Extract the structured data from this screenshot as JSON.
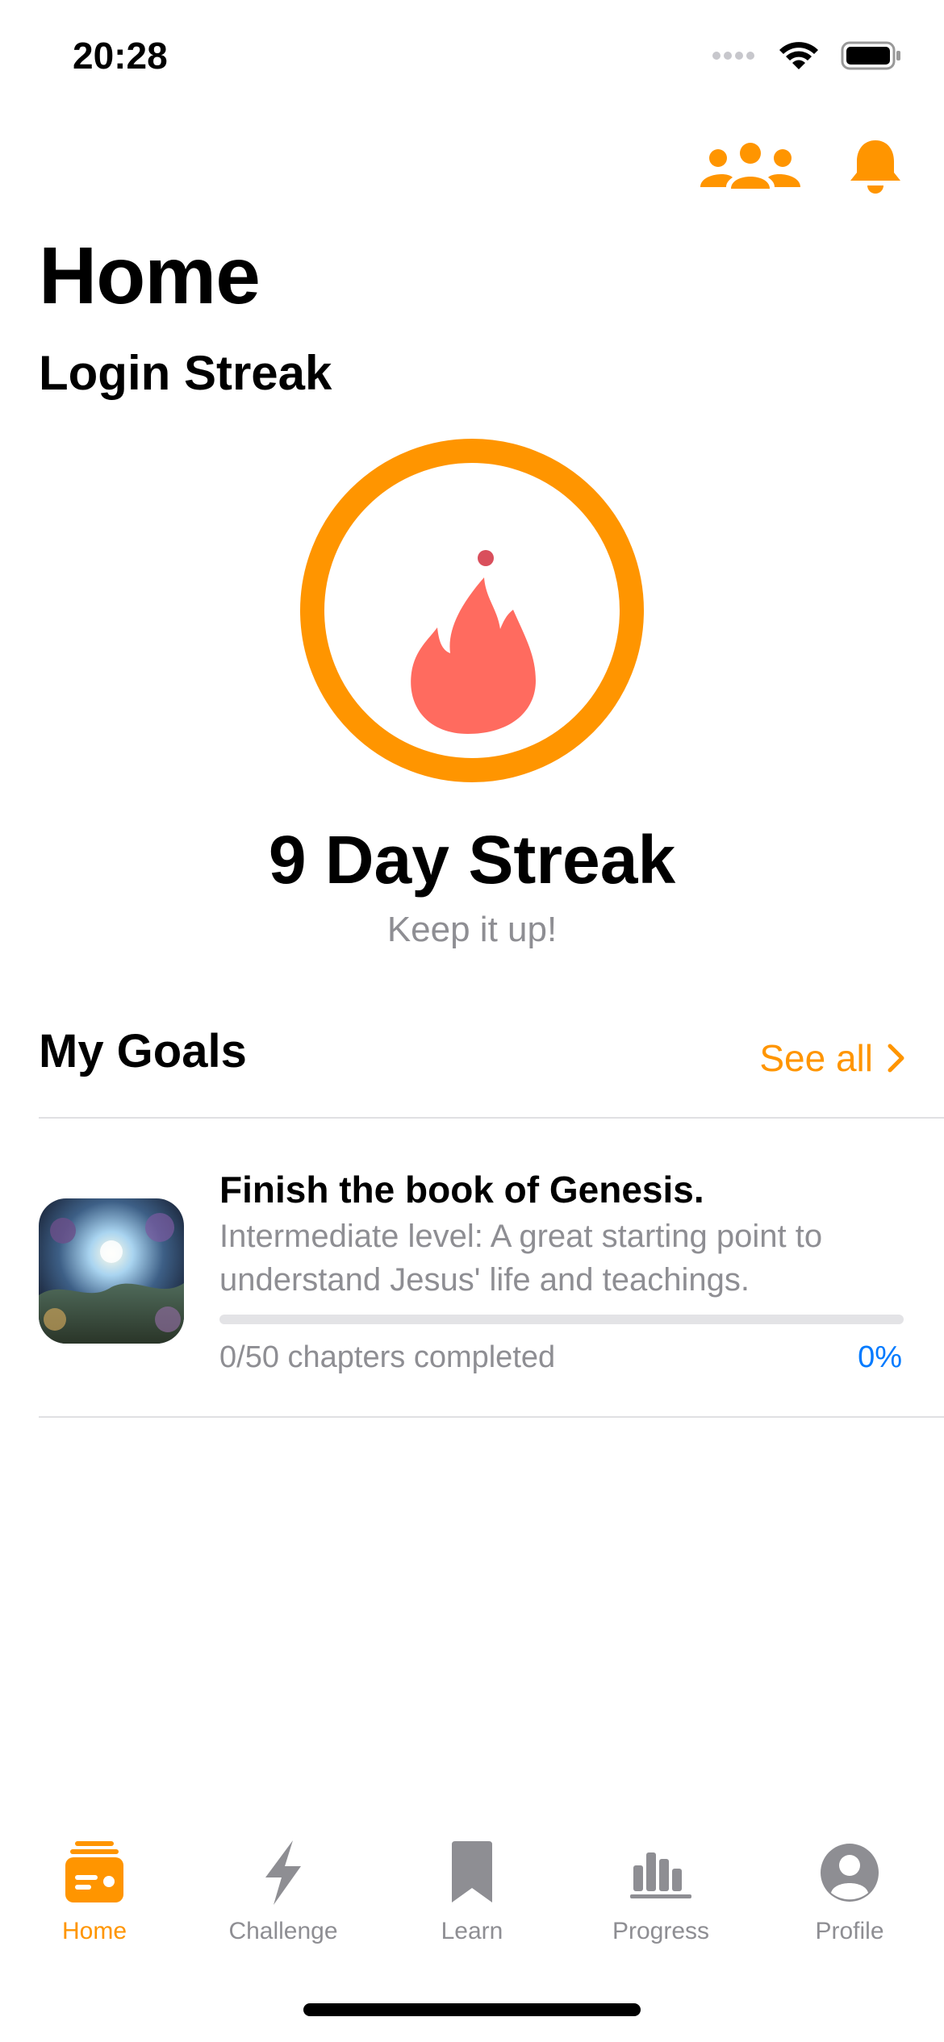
{
  "status_bar": {
    "time": "20:28"
  },
  "header": {
    "title": "Home",
    "friends_icon": "people-icon",
    "notifications_icon": "bell-icon"
  },
  "streak": {
    "section_title": "Login Streak",
    "count_text": "9 Day Streak",
    "subtitle": "Keep it up!",
    "ring_color": "#ff9500",
    "flame_color": "#ff6b5f"
  },
  "goals": {
    "section_title": "My Goals",
    "see_all_label": "See all",
    "items": [
      {
        "title": "Finish the book of Genesis.",
        "description": "Intermediate level: A great starting point to understand Jesus' life and teachings.",
        "progress_label": "0/50 chapters completed",
        "progress_percent_text": "0%",
        "progress_fraction": 0
      }
    ]
  },
  "tabbar": {
    "accent": "#ff9500",
    "tabs": [
      {
        "label": "Home",
        "icon": "home-card-icon",
        "active": true
      },
      {
        "label": "Challenge",
        "icon": "bolt-icon",
        "active": false
      },
      {
        "label": "Learn",
        "icon": "bookmark-icon",
        "active": false
      },
      {
        "label": "Progress",
        "icon": "bar-chart-icon",
        "active": false
      },
      {
        "label": "Profile",
        "icon": "person-circle-icon",
        "active": false
      }
    ]
  }
}
